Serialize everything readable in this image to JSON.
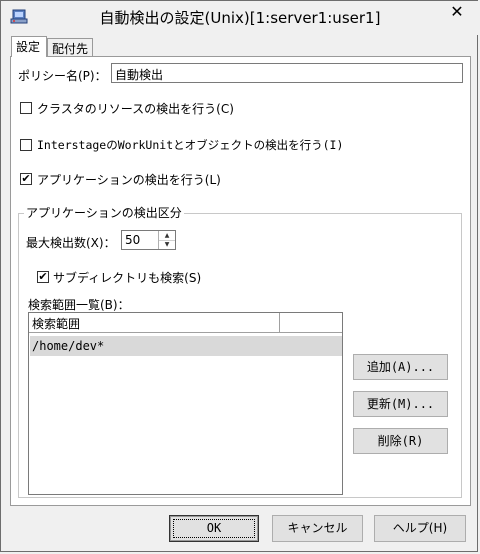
{
  "window": {
    "title": "自動検出の設定(Unix)[1:server1:user1]",
    "close_label": "✕"
  },
  "tabs": [
    {
      "label": "設定"
    },
    {
      "label": "配付先"
    }
  ],
  "policy": {
    "label": "ポリシー名(P)：",
    "value": "自動検出"
  },
  "checkboxes": {
    "cluster": {
      "label": "クラスタのリソースの検出を行う(C)",
      "checked": false
    },
    "interstage": {
      "label": "InterstageのWorkUnitとオブジェクトの検出を行う(I)",
      "checked": false
    },
    "application": {
      "label": "アプリケーションの検出を行う(L)",
      "checked": true
    }
  },
  "app_group": {
    "title": "アプリケーションの検出区分",
    "max_label": "最大検出数(X)：",
    "max_value": "50",
    "subdir_label": "サブディレクトリも検索(S)",
    "subdir_checked": true,
    "list_label": "検索範囲一覧(B)：",
    "list_header": "検索範囲",
    "rows": [
      "/home/dev*"
    ],
    "add_label": "追加(A)...",
    "update_label": "更新(M)...",
    "delete_label": "削除(R)"
  },
  "footer": {
    "ok_label": "OK",
    "cancel_label": "キャンセル",
    "help_label": "ヘルプ(H)"
  },
  "check_mark": "✔"
}
